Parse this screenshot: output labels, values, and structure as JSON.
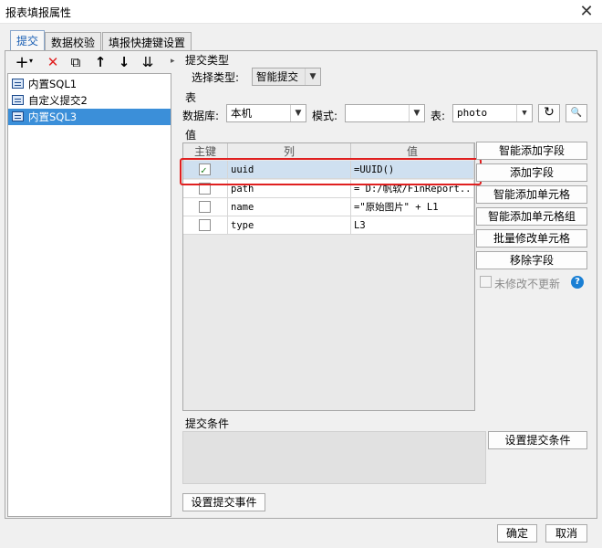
{
  "window": {
    "title": "报表填报属性",
    "close_glyph": "✕"
  },
  "tabs": [
    "提交",
    "数据校验",
    "填报快捷键设置"
  ],
  "toolbar": {
    "add": "+",
    "add_arrow": "▾",
    "delete": "✕",
    "copy": "⧉",
    "up": "↑",
    "down": "↓",
    "sort": "⇊",
    "more": "▸"
  },
  "submissions": [
    "内置SQL1",
    "自定义提交2",
    "内置SQL3"
  ],
  "submit_type": {
    "section": "提交类型",
    "label": "选择类型:",
    "value": "智能提交"
  },
  "table_section": {
    "section": "表",
    "db_label": "数据库:",
    "db_value": "本机",
    "mode_label": "模式:",
    "mode_value": "",
    "table_label": "表:",
    "table_value": "photo",
    "refresh_glyph": "↻",
    "preview_glyph": "🔍"
  },
  "values": {
    "section": "值",
    "headers": [
      "主键",
      "列",
      "值"
    ],
    "rows": [
      {
        "key": true,
        "column": "uuid",
        "value": "=UUID()"
      },
      {
        "key": false,
        "column": "path",
        "value": "= D:/帆软/FinReport..."
      },
      {
        "key": false,
        "column": "name",
        "value": "=\"原始图片\" + L1"
      },
      {
        "key": false,
        "column": "type",
        "value": "L3"
      }
    ]
  },
  "side_buttons": [
    "智能添加字段",
    "添加字段",
    "智能添加单元格",
    "智能添加单元格组",
    "批量修改单元格",
    "移除字段"
  ],
  "no_update_label": "未修改不更新",
  "help_glyph": "?",
  "condition": {
    "section": "提交条件",
    "button": "设置提交条件"
  },
  "event_button": "设置提交事件",
  "footer": {
    "ok": "确定",
    "cancel": "取消"
  },
  "colors": {
    "accent": "#3b8fd9",
    "highlight": "#e02020",
    "delete": "#e02020"
  }
}
